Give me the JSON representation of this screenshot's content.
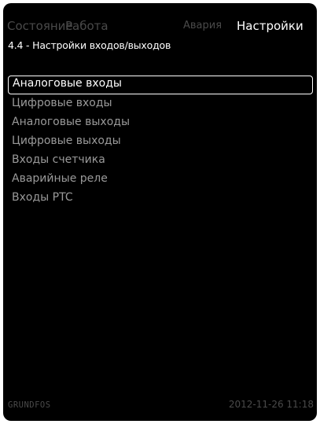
{
  "tabs": [
    {
      "label": "Состояние"
    },
    {
      "label": "Работа"
    },
    {
      "label": "Авария"
    },
    {
      "label": "Настройки"
    }
  ],
  "header": {
    "title": "4.4 - Настройки входов/выходов"
  },
  "menu": {
    "items": [
      {
        "label": "Аналоговые входы"
      },
      {
        "label": "Цифровые входы"
      },
      {
        "label": "Аналоговые выходы"
      },
      {
        "label": "Цифровые выходы"
      },
      {
        "label": "Входы счетчика"
      },
      {
        "label": "Аварийные реле"
      },
      {
        "label": "Входы PTC"
      }
    ],
    "selected_index": 0
  },
  "footer": {
    "brand": "GRUNDFOS",
    "datetime": "2012-11-26 11:18"
  },
  "colors": {
    "background": "#000000",
    "active_text": "#ffffff",
    "inactive_tab": "#4a4a4a",
    "menu_text": "#9a9a9a"
  }
}
